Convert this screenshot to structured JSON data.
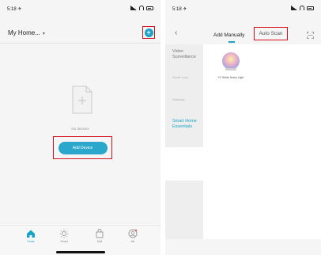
{
  "left_screen": {
    "status_time": "5:18 ✈",
    "home_title": "My Home...",
    "home_caret": "▾",
    "add_icon": "+",
    "empty_text": "No devices",
    "add_device_label": "Add Device",
    "tabs": [
      {
        "label": "Home",
        "icon": "home-icon"
      },
      {
        "label": "Smart",
        "icon": "sun-icon"
      },
      {
        "label": "Mall",
        "icon": "shop-icon"
      },
      {
        "label": "Me",
        "icon": "person-icon"
      }
    ]
  },
  "right_screen": {
    "status_time": "5:18 ✈",
    "back_icon": "‹",
    "nav_tabs": {
      "manual": "Add Manually",
      "auto_scan": "Auto Scan"
    },
    "categories": [
      {
        "label": "Video Surveillance"
      },
      {
        "label": "Smart Lock"
      },
      {
        "label": "Gateway"
      },
      {
        "label": "Smart Home Essentials"
      }
    ],
    "device": {
      "name": "Y2 White Noise Light",
      "icon": "noise-light-icon"
    }
  },
  "colors": {
    "accent": "#19a3c7",
    "highlight_box": "#d10f1f",
    "background": "#f5f5f5"
  }
}
